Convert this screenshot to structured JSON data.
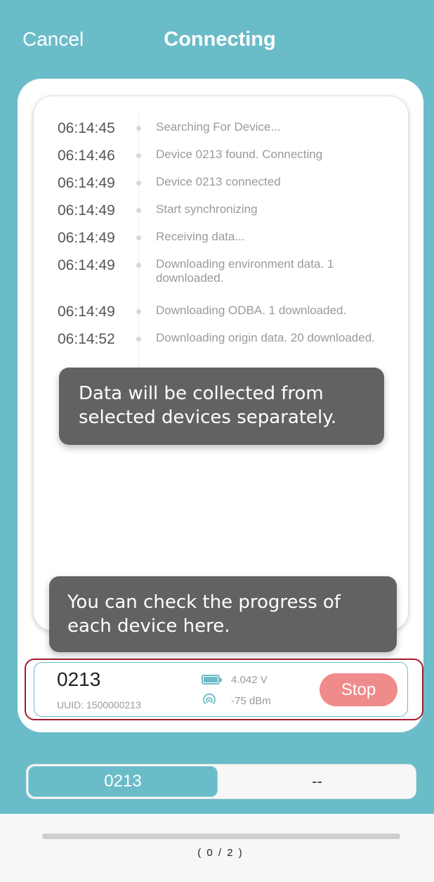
{
  "header": {
    "cancel_label": "Cancel",
    "title": "Connecting"
  },
  "log": {
    "entries": [
      {
        "time": "06:14:45",
        "message": "Searching For Device..."
      },
      {
        "time": "06:14:46",
        "message": "Device 0213 found. Connecting"
      },
      {
        "time": "06:14:49",
        "message": "Device 0213 connected"
      },
      {
        "time": "06:14:49",
        "message": "Start synchronizing"
      },
      {
        "time": "06:14:49",
        "message": "Receiving data..."
      },
      {
        "time": "06:14:49",
        "message": "Downloading environment data. 1 downloaded."
      },
      {
        "time": "06:14:49",
        "message": "Downloading ODBA. 1 downloaded."
      },
      {
        "time": "06:14:52",
        "message": "Downloading origin data. 20 downloaded."
      }
    ]
  },
  "tooltips": {
    "collection_hint": "Data will be collected from selected devices separately.",
    "progress_hint": "You can check the progress of each device here."
  },
  "device": {
    "name": "0213",
    "uuid": "UUID: 1500000213",
    "voltage": "4.042 V",
    "rssi": "-75 dBm",
    "stop_label": "Stop",
    "battery_level": 1.0
  },
  "device_tabs": {
    "items": [
      {
        "label": "0213",
        "active": true
      },
      {
        "label": "--",
        "active": false
      }
    ]
  },
  "progress": {
    "completed": 0,
    "total": 2,
    "label": "( 0 / 2 )"
  },
  "colors": {
    "accent": "#6bbcc9",
    "stop": "#f08b8b",
    "highlight_outline": "#a11d2a"
  },
  "icons": {
    "battery": "battery-icon",
    "signal": "signal-icon"
  }
}
